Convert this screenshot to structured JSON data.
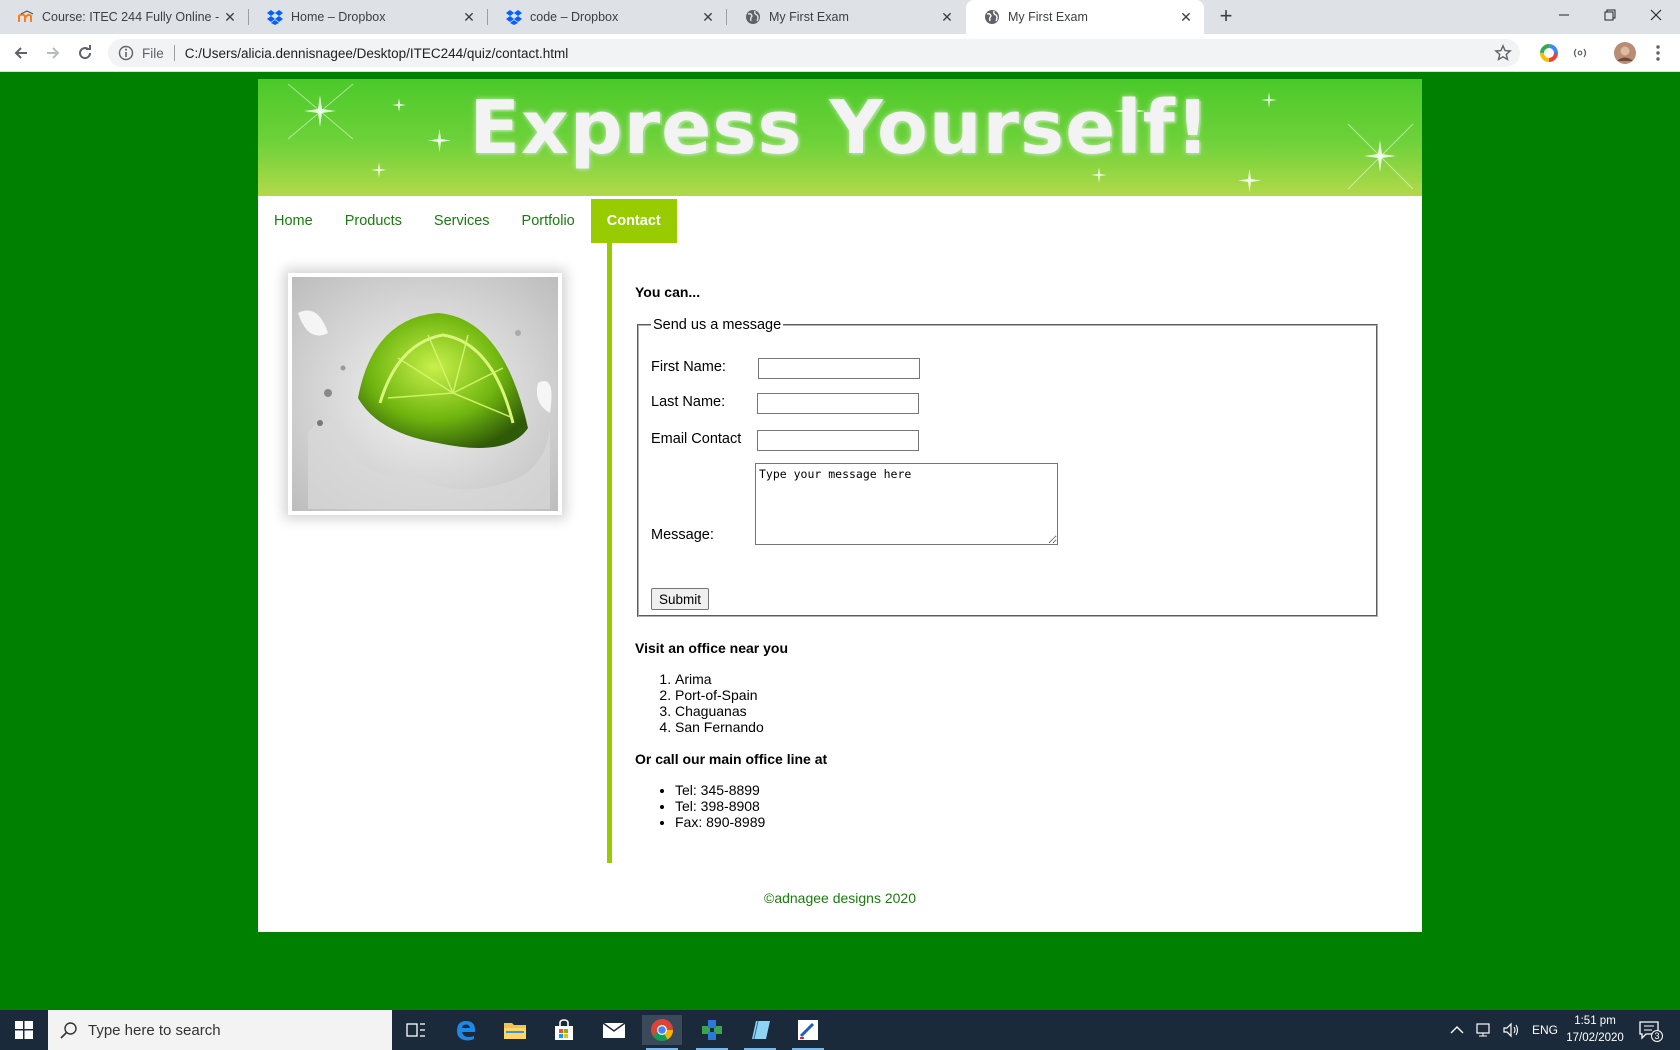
{
  "browser": {
    "tabs": [
      {
        "title": "Course: ITEC 244 Fully Online - In",
        "favicon": "moodle-icon",
        "active": false
      },
      {
        "title": "Home – Dropbox",
        "favicon": "dropbox-icon",
        "active": false
      },
      {
        "title": "code – Dropbox",
        "favicon": "dropbox-icon",
        "active": false
      },
      {
        "title": "My First Exam",
        "favicon": "globe-icon",
        "active": false
      },
      {
        "title": "My First Exam",
        "favicon": "globe-icon",
        "active": true
      }
    ],
    "new_tab_label": "+",
    "address": {
      "scheme": "File",
      "url": "C:/Users/alicia.dennisnagee/Desktop/ITEC244/quiz/contact.html"
    }
  },
  "site": {
    "banner_title": "Express Yourself!",
    "nav": [
      {
        "label": "Home",
        "active": false
      },
      {
        "label": "Products",
        "active": false
      },
      {
        "label": "Services",
        "active": false
      },
      {
        "label": "Portfolio",
        "active": false
      },
      {
        "label": "Contact",
        "active": true
      }
    ],
    "you_can": "You can...",
    "form": {
      "legend": "Send us a message",
      "first_name_label": "First Name:",
      "last_name_label": "Last Name:",
      "email_label": "Email Contact",
      "message_label": "Message:",
      "message_value": "Type your message here",
      "submit_label": "Submit"
    },
    "visit_heading": "Visit an office near you",
    "offices": [
      "Arima",
      "Port-of-Spain",
      "Chaguanas",
      "San Fernando"
    ],
    "call_heading": "Or call our main office line at",
    "phones": [
      "Tel: 345-8899",
      "Tel: 398-8908",
      "Fax: 890-8989"
    ],
    "footer": "©adnagee designs 2020"
  },
  "taskbar": {
    "search_placeholder": "Type here to search",
    "language": "ENG",
    "time": "1:51 pm",
    "date": "17/02/2020",
    "notification_count": "3"
  },
  "colors": {
    "page_background": "#008000",
    "accent_green": "#99cc00",
    "link_green": "#1c7a10"
  }
}
